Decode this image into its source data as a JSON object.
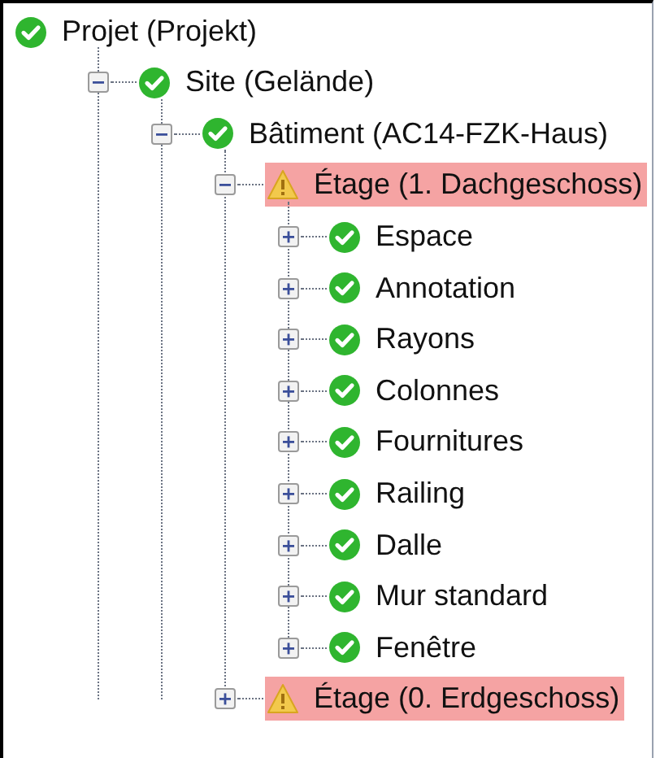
{
  "tree": {
    "label": "Projet (Projekt)",
    "kind": "ok",
    "children": [
      {
        "label": "Site (Gelände)",
        "kind": "ok",
        "expanded": true,
        "children": [
          {
            "label": "Bâtiment (AC14-FZK-Haus)",
            "kind": "ok",
            "expanded": true,
            "children": [
              {
                "label": "Étage (1. Dachgeschoss)",
                "kind": "warning",
                "expanded": true,
                "children": [
                  {
                    "label": "Espace",
                    "kind": "ok",
                    "expanded": false
                  },
                  {
                    "label": "Annotation",
                    "kind": "ok",
                    "expanded": false
                  },
                  {
                    "label": "Rayons",
                    "kind": "ok",
                    "expanded": false
                  },
                  {
                    "label": "Colonnes",
                    "kind": "ok",
                    "expanded": false
                  },
                  {
                    "label": "Fournitures",
                    "kind": "ok",
                    "expanded": false
                  },
                  {
                    "label": "Railing",
                    "kind": "ok",
                    "expanded": false
                  },
                  {
                    "label": "Dalle",
                    "kind": "ok",
                    "expanded": false
                  },
                  {
                    "label": "Mur standard",
                    "kind": "ok",
                    "expanded": false
                  },
                  {
                    "label": "Fenêtre",
                    "kind": "ok",
                    "expanded": false
                  }
                ]
              },
              {
                "label": "Étage (0. Erdgeschoss)",
                "kind": "warning",
                "expanded": false
              }
            ]
          }
        ]
      }
    ]
  }
}
